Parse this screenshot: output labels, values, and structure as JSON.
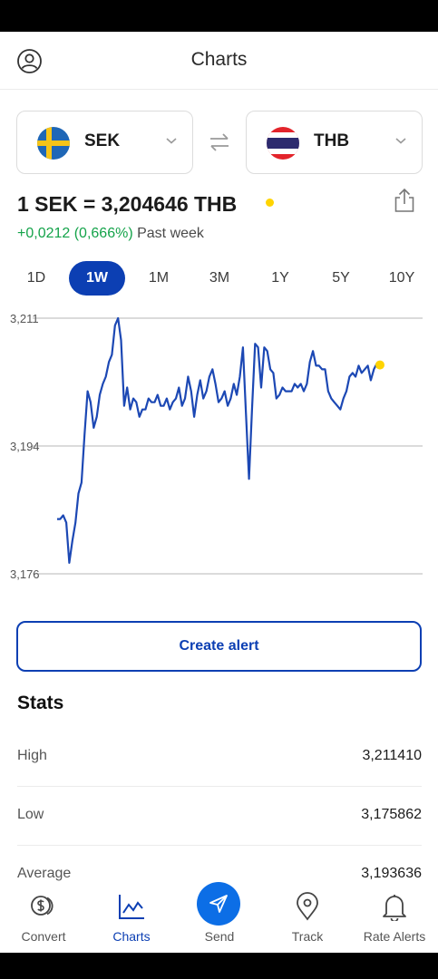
{
  "header": {
    "title": "Charts"
  },
  "pair": {
    "from": {
      "code": "SEK",
      "flag": "sweden-flag-icon"
    },
    "to": {
      "code": "THB",
      "flag": "thailand-flag-icon"
    }
  },
  "rate": {
    "text": "1 SEK = 3,204646 THB",
    "change": "+0,0212 (0,666%)",
    "period_label": "Past week"
  },
  "periods": [
    "1D",
    "1W",
    "1M",
    "3M",
    "1Y",
    "5Y",
    "10Y"
  ],
  "active_period": "1W",
  "chart_data": {
    "type": "line",
    "ylim": [
      3.176,
      3.211
    ],
    "yticks": [
      "3,211",
      "3,194",
      "3,176"
    ],
    "grid": true,
    "x": [
      0,
      1,
      2,
      3,
      4,
      5,
      6,
      7,
      8,
      9,
      10,
      11,
      12,
      13,
      14,
      15,
      16,
      17,
      18,
      19,
      20,
      21,
      22,
      23,
      24,
      25,
      26,
      27,
      28,
      29,
      30,
      31,
      32,
      33,
      34,
      35,
      36,
      37,
      38,
      39,
      40,
      41,
      42,
      43,
      44,
      45,
      46,
      47,
      48,
      49,
      50,
      51,
      52,
      53,
      54,
      55,
      56,
      57,
      58,
      59,
      60,
      61,
      62,
      63,
      64,
      65,
      66,
      67,
      68,
      69,
      70,
      71,
      72,
      73,
      74,
      75,
      76,
      77,
      78,
      79,
      80,
      81,
      82,
      83,
      84,
      85,
      86,
      87,
      88,
      89,
      90,
      91,
      92,
      93,
      94,
      95,
      96,
      97,
      98,
      99,
      100,
      101,
      102,
      103,
      104,
      105,
      106,
      107,
      108,
      109,
      110,
      111,
      112,
      113,
      114,
      115,
      116,
      117,
      118,
      119,
      120
    ],
    "series": [
      {
        "values": [
          3.1835,
          3.1835,
          3.184,
          3.183,
          3.1775,
          3.1805,
          3.183,
          3.187,
          3.1885,
          3.195,
          3.201,
          3.1995,
          3.196,
          3.1975,
          3.2005,
          3.202,
          3.203,
          3.205,
          3.206,
          3.21,
          3.211,
          3.208,
          3.199,
          3.2015,
          3.1985,
          3.2,
          3.1995,
          3.1975,
          3.1985,
          3.1985,
          3.2,
          3.1995,
          3.1995,
          3.2005,
          3.199,
          3.199,
          3.2,
          3.1985,
          3.1995,
          3.2,
          3.2015,
          3.199,
          3.2,
          3.203,
          3.201,
          3.1975,
          3.2005,
          3.2025,
          3.2,
          3.201,
          3.203,
          3.204,
          3.202,
          3.1995,
          3.2,
          3.201,
          3.199,
          3.2,
          3.202,
          3.2005,
          3.203,
          3.207,
          3.198,
          3.189,
          3.1985,
          3.2075,
          3.207,
          3.2015,
          3.207,
          3.2065,
          3.204,
          3.2035,
          3.2,
          3.2005,
          3.2015,
          3.201,
          3.201,
          3.201,
          3.202,
          3.2015,
          3.202,
          3.201,
          3.202,
          3.205,
          3.2065,
          3.2045,
          3.2045,
          3.204,
          3.204,
          3.201,
          3.2,
          3.1995,
          3.199,
          3.1985,
          3.2,
          3.201,
          3.203,
          3.2035,
          3.203,
          3.2045,
          3.2035,
          3.204,
          3.2045,
          3.2025,
          3.204,
          3.2048,
          3.2046
        ],
        "color": "#1c48b4"
      }
    ],
    "last_point_color": "#ffd400"
  },
  "actions": {
    "create_alert": "Create alert"
  },
  "stats": {
    "title": "Stats",
    "rows": [
      {
        "label": "High",
        "value": "3,211410"
      },
      {
        "label": "Low",
        "value": "3,175862"
      },
      {
        "label": "Average",
        "value": "3,193636"
      }
    ]
  },
  "nav": [
    {
      "label": "Convert",
      "icon": "convert-coins-icon"
    },
    {
      "label": "Charts",
      "icon": "charts-icon"
    },
    {
      "label": "Send",
      "icon": "send-icon"
    },
    {
      "label": "Track",
      "icon": "location-pin-icon"
    },
    {
      "label": "Rate Alerts",
      "icon": "bell-icon"
    }
  ],
  "colors": {
    "accent": "#0c3fb3",
    "positive": "#14a34a",
    "send_button": "#0c6ee6",
    "live": "#ffd400"
  }
}
